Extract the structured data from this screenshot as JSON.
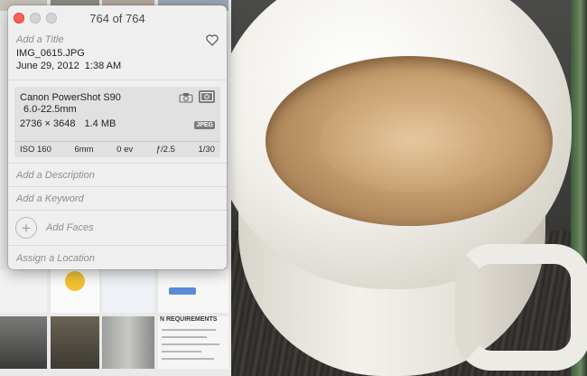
{
  "window": {
    "title": "764 of 764"
  },
  "info": {
    "title_placeholder": "Add a Title",
    "filename": "IMG_0615.JPG",
    "date": "June 29, 2012",
    "time": "1:38 AM"
  },
  "exif": {
    "camera": "Canon PowerShot S90",
    "lens": "6.0-22.5mm",
    "dimensions": "2736 × 3648",
    "filesize": "1.4 MB",
    "format": "JPEG",
    "iso": "ISO 160",
    "focal_length": "6mm",
    "exposure_bias": "0 ev",
    "aperture": "ƒ/2.5",
    "shutter": "1/30"
  },
  "actions": {
    "description_placeholder": "Add a Description",
    "keyword_placeholder": "Add a Keyword",
    "faces_label": "Add Faces",
    "location_placeholder": "Assign a Location"
  },
  "thumbs": {
    "requirements_heading": "N REQUIREMENTS"
  },
  "colors": {
    "close": "#fc5f57",
    "panel_bg": "#f0efef",
    "exif_bg": "#e2e1e1"
  },
  "icons": [
    "heart-icon",
    "camera-icon",
    "metering-icon",
    "plus-icon"
  ]
}
